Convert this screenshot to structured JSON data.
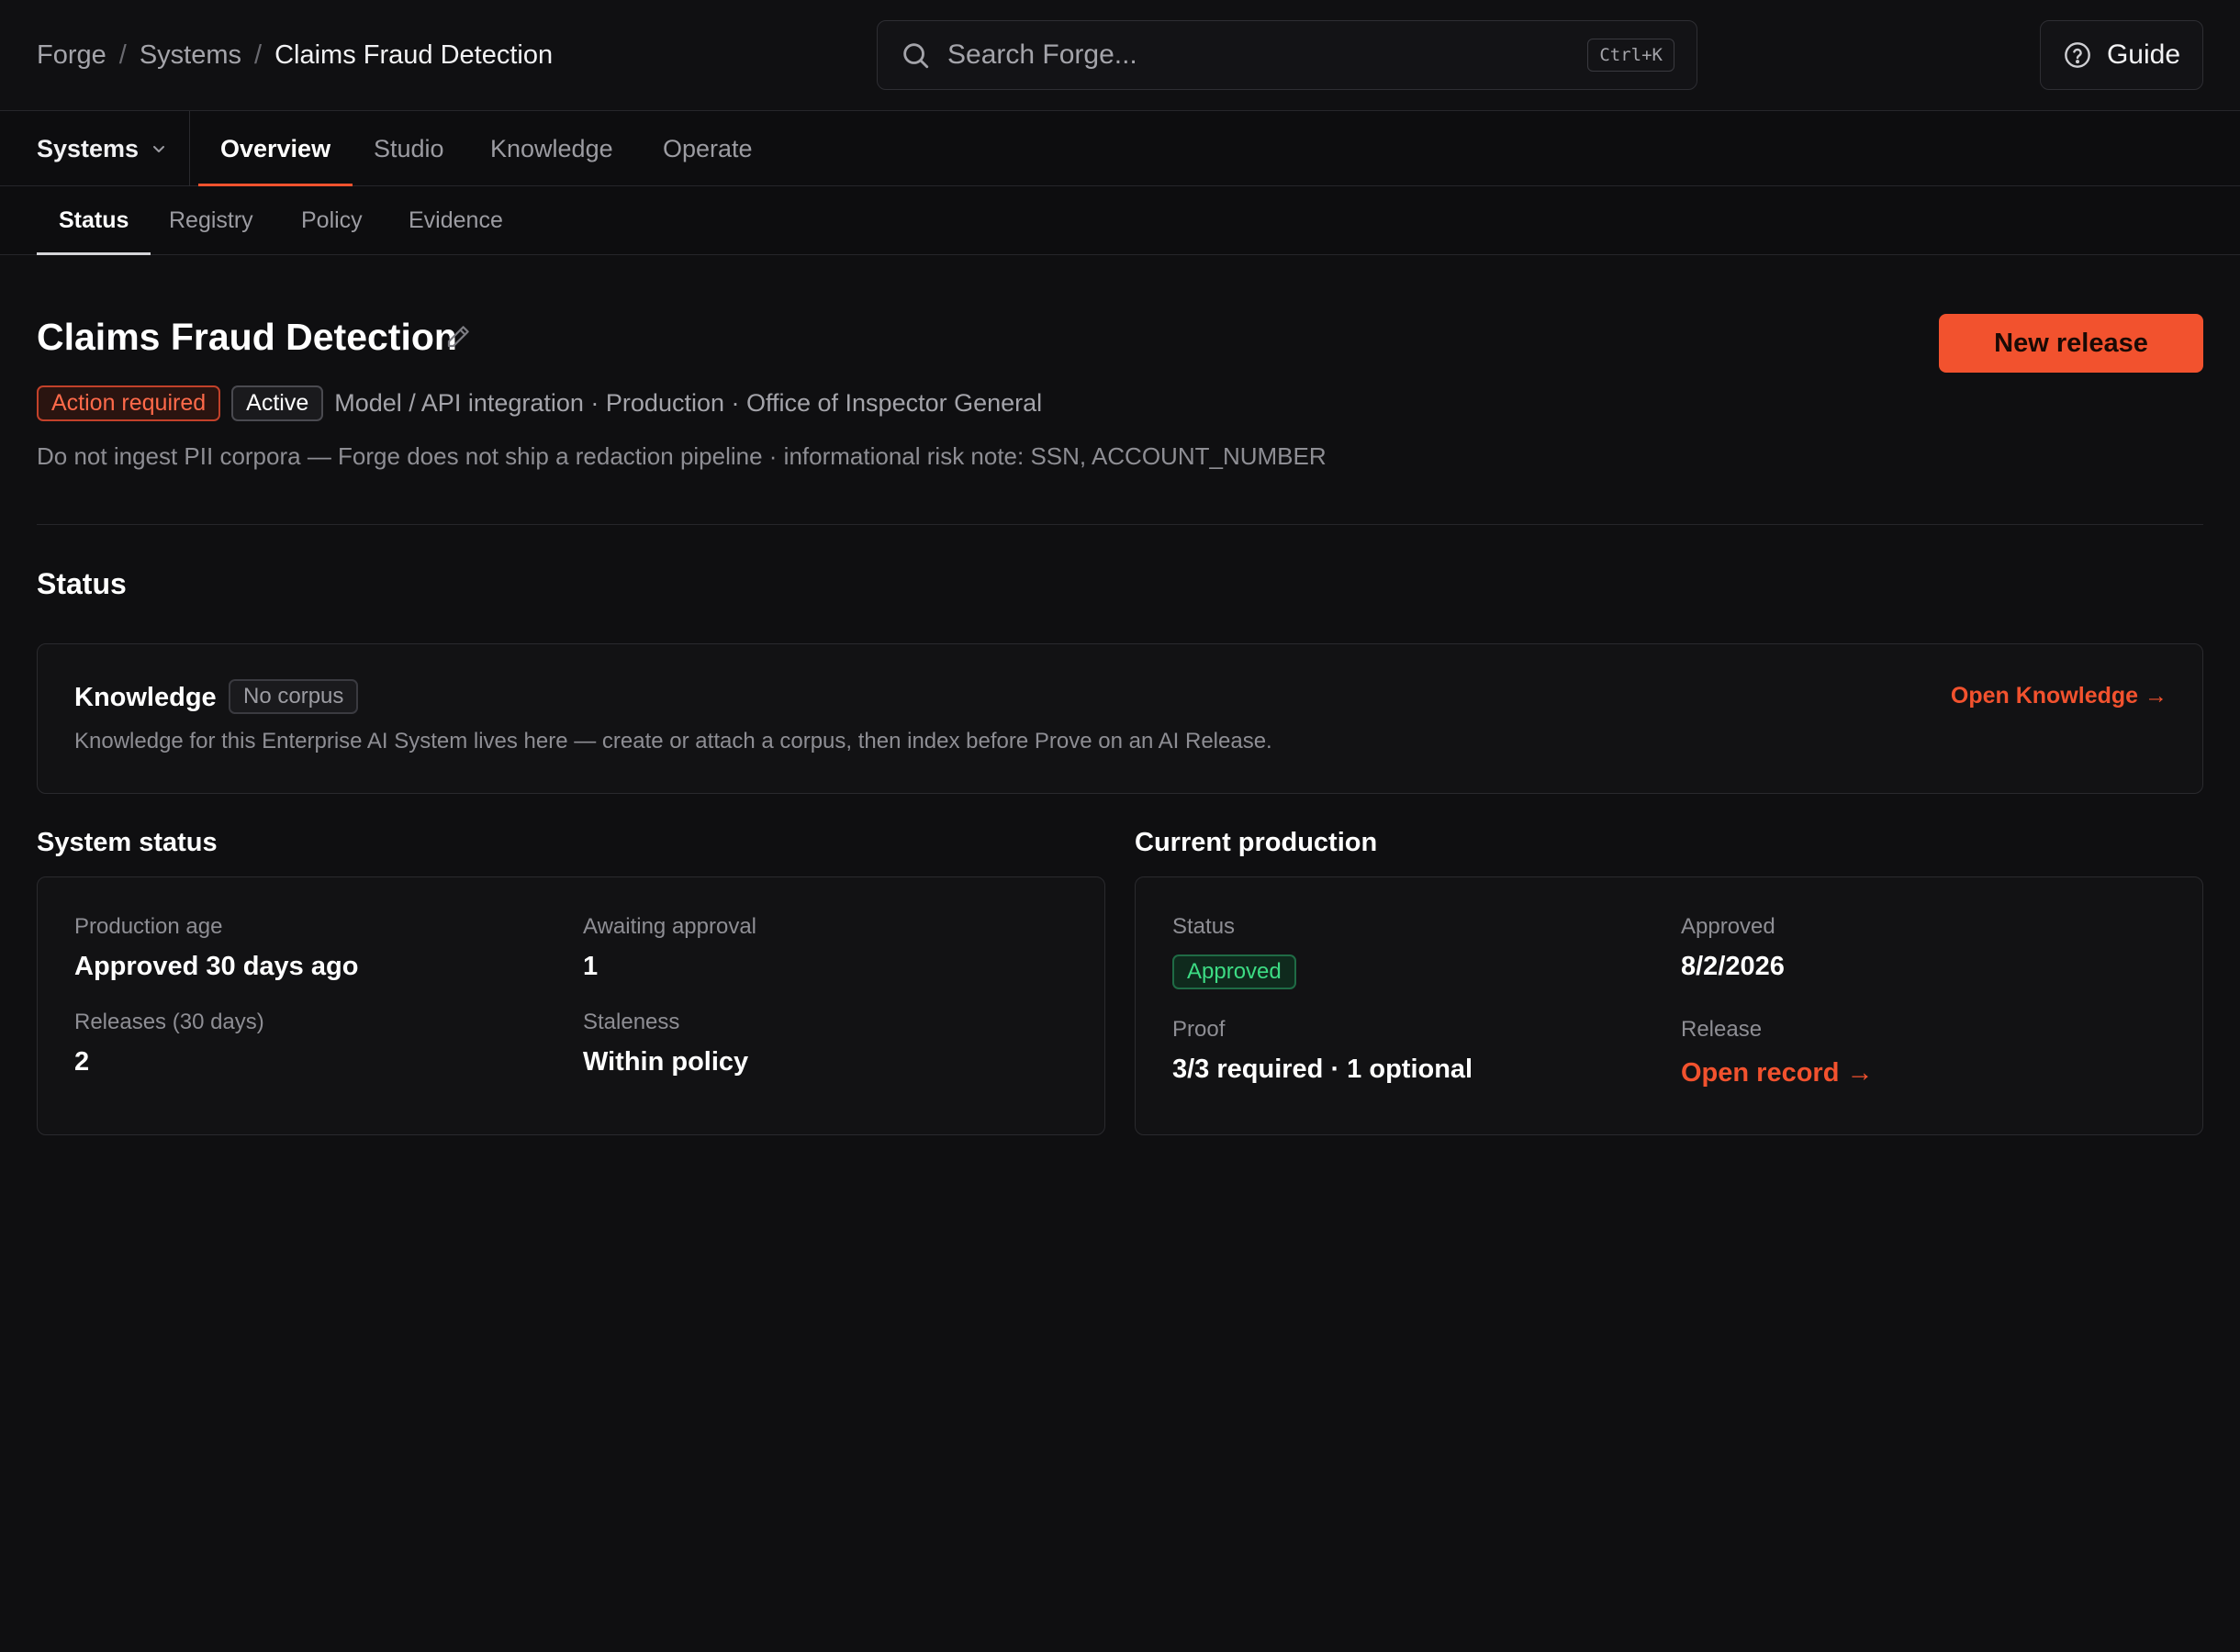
{
  "breadcrumb": {
    "root": "Forge",
    "section": "Systems",
    "current": "Claims Fraud Detection"
  },
  "search": {
    "placeholder": "Search Forge...",
    "shortcut": "Ctrl+K"
  },
  "guide": {
    "label": "Guide"
  },
  "main_nav": {
    "dropdown_label": "Systems",
    "tabs": [
      {
        "label": "Overview",
        "active": true
      },
      {
        "label": "Studio"
      },
      {
        "label": "Knowledge"
      },
      {
        "label": "Operate"
      }
    ]
  },
  "sub_nav": {
    "tabs": [
      {
        "label": "Status",
        "active": true
      },
      {
        "label": "Registry"
      },
      {
        "label": "Policy"
      },
      {
        "label": "Evidence"
      }
    ]
  },
  "header": {
    "title": "Claims Fraud Detection",
    "primary_action": "New release",
    "badges": {
      "action": "Action required",
      "state": "Active"
    },
    "meta": "Model / API integration · Production · Office of Inspector General",
    "note": "Do not ingest PII corpora — Forge does not ship a redaction pipeline · informational risk note: SSN, ACCOUNT_NUMBER"
  },
  "status_section": {
    "title": "Status"
  },
  "knowledge_card": {
    "title": "Knowledge",
    "badge": "No corpus",
    "description": "Knowledge for this Enterprise AI System lives here — create or attach a corpus, then index before Prove on an AI Release.",
    "link": "Open Knowledge →"
  },
  "system_status": {
    "title": "System status",
    "production_age_label": "Production age",
    "production_age_value": "Approved 30 days ago",
    "awaiting_label": "Awaiting approval",
    "awaiting_value": "1",
    "releases_label": "Releases (30 days)",
    "releases_value": "2",
    "staleness_label": "Staleness",
    "staleness_value": "Within policy"
  },
  "current_production": {
    "title": "Current production",
    "status_label": "Status",
    "status_value": "Approved",
    "approved_label": "Approved",
    "approved_value": "8/2/2026",
    "proof_label": "Proof",
    "proof_value": "3/3 required · 1 optional",
    "release_label": "Release",
    "release_link": "Open record →"
  },
  "colors": {
    "accent": "#f2522e",
    "success": "#3ddc84",
    "danger": "#ff6a4a",
    "background": "#0f0f11"
  }
}
